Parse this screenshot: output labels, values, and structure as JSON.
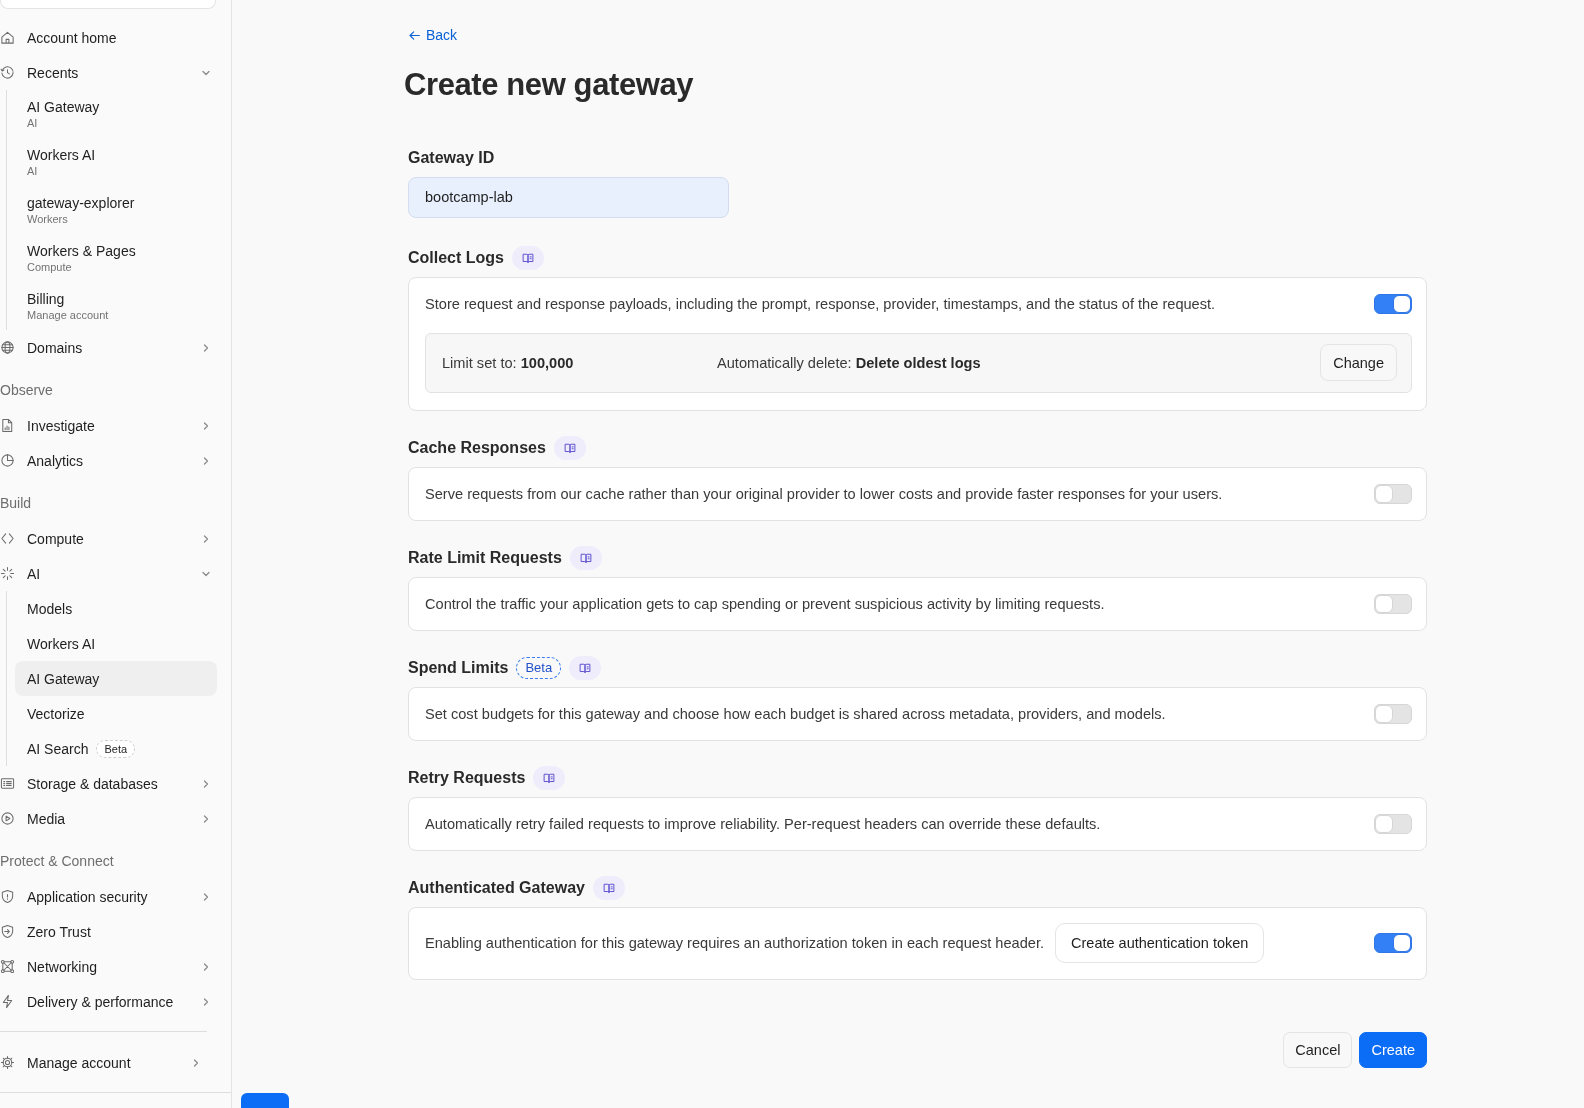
{
  "sidebar": {
    "sections": [
      {
        "items": [
          {
            "label": "Account home",
            "kind": "link"
          },
          {
            "label": "Recents",
            "kind": "group",
            "expanded": true,
            "children": [
              {
                "label": "AI Gateway",
                "caption": "AI",
                "selected": false
              },
              {
                "label": "Workers AI",
                "caption": "AI",
                "selected": false
              },
              {
                "label": "gateway-explorer",
                "caption": "Workers",
                "selected": false
              },
              {
                "label": "Workers & Pages",
                "caption": "Compute",
                "selected": false
              },
              {
                "label": "Billing",
                "caption": "Manage account",
                "selected": false
              }
            ]
          },
          {
            "label": "Domains",
            "kind": "group",
            "expanded": false
          }
        ]
      },
      {
        "title": "Observe",
        "items": [
          {
            "label": "Investigate",
            "kind": "group",
            "expanded": false
          },
          {
            "label": "Analytics",
            "kind": "group",
            "expanded": false
          }
        ]
      },
      {
        "title": "Build",
        "items": [
          {
            "label": "Compute",
            "kind": "group",
            "expanded": false
          },
          {
            "label": "AI",
            "kind": "group",
            "expanded": true,
            "children": [
              {
                "label": "Models",
                "selected": false
              },
              {
                "label": "Workers AI",
                "selected": false
              },
              {
                "label": "AI Gateway",
                "selected": true
              },
              {
                "label": "Vectorize",
                "selected": false
              },
              {
                "label": "AI Search",
                "badge": "Beta",
                "selected": false
              }
            ]
          },
          {
            "label": "Storage & databases",
            "kind": "group",
            "expanded": false
          },
          {
            "label": "Media",
            "kind": "group",
            "expanded": false
          }
        ]
      },
      {
        "title": "Protect & Connect",
        "items": [
          {
            "label": "Application security",
            "kind": "group",
            "expanded": false
          },
          {
            "label": "Zero Trust",
            "kind": "link"
          },
          {
            "label": "Networking",
            "kind": "group",
            "expanded": false
          },
          {
            "label": "Delivery & performance",
            "kind": "group",
            "expanded": false
          }
        ]
      }
    ],
    "footer": {
      "items": [
        {
          "label": "Manage account",
          "kind": "group",
          "expanded": false
        }
      ]
    }
  },
  "back_link": {
    "label": "Back"
  },
  "title": "Create new gateway",
  "gateway_id": {
    "label": "Gateway ID",
    "value": "bootcamp-lab"
  },
  "settings": [
    {
      "kind": "logs",
      "title": "Collect Logs",
      "description": "Store request and response payloads, including the prompt, response, provider, timestamps, and the status of the request.",
      "on": true,
      "limit_text": "Limit set to: **100,000**",
      "auto_delete_text": "Automatically delete: **Delete oldest logs**",
      "button": "Change"
    },
    {
      "kind": "toggle",
      "title": "Cache Responses",
      "description": "Serve requests from our cache rather than your original provider to lower costs and provide faster responses for your users.",
      "on": false
    },
    {
      "kind": "toggle",
      "title": "Rate Limit Requests",
      "description": "Control the traffic your application gets to cap spending or prevent suspicious activity by limiting requests.",
      "on": false
    },
    {
      "kind": "toggle",
      "title": "Spend Limits",
      "badge": "Beta",
      "description": "Set cost budgets for this gateway and choose how each budget is shared across metadata, providers, and models.",
      "on": false
    },
    {
      "kind": "toggle",
      "title": "Retry Requests",
      "description": "Automatically retry failed requests to improve reliability. Per-request headers can override these defaults.",
      "on": false
    },
    {
      "kind": "token",
      "title": "Authenticated Gateway",
      "description": "Enabling authentication for this gateway requires an authorization token in each request header.",
      "button": "Create authentication token",
      "on": true
    }
  ],
  "actions": [
    {
      "label": "Cancel",
      "kind": "secondary"
    },
    {
      "label": "Create",
      "kind": "primary"
    }
  ]
}
